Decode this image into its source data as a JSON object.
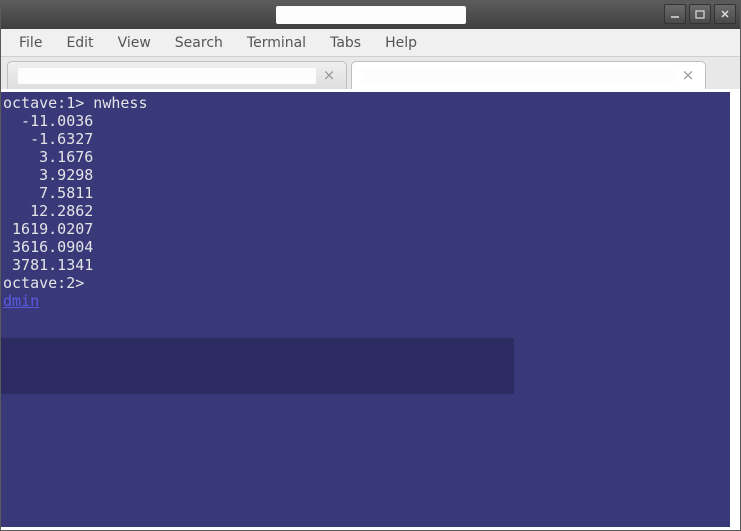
{
  "menubar": {
    "items": [
      "File",
      "Edit",
      "View",
      "Search",
      "Terminal",
      "Tabs",
      "Help"
    ]
  },
  "window_controls": {
    "minimize": "minimize",
    "maximize": "maximize",
    "close": "close"
  },
  "tabs": {
    "tab1_close": "×",
    "tab2_close": "×"
  },
  "terminal": {
    "line0": "octave:1> nwhess",
    "line1": "  -11.0036",
    "line2": "   -1.6327",
    "line3": "    3.1676",
    "line4": "    3.9298",
    "line5": "    7.5811",
    "line6": "   12.2862",
    "line7": " 1619.0207",
    "line8": " 3616.0904",
    "line9": " 3781.1341",
    "line10": "octave:2> ",
    "link": "dmin"
  }
}
